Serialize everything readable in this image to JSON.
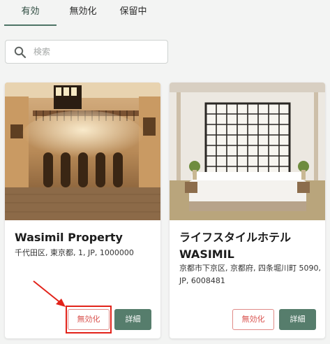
{
  "tabs": [
    {
      "label": "有効",
      "active": true
    },
    {
      "label": "無効化",
      "active": false
    },
    {
      "label": "保留中",
      "active": false
    }
  ],
  "search": {
    "placeholder": "検索",
    "icon": "search-icon"
  },
  "properties": [
    {
      "name": "Wasimil Property",
      "address": "千代田区, 東京都, 1, JP, 1000000",
      "disable_label": "無効化",
      "detail_label": "詳細",
      "image": "hotel-lobby-photo"
    },
    {
      "name": "ライフスタイルホテル WASIMIL",
      "address": "京都市下京区, 京都府, 四条堀川町 5090, JP, 6008481",
      "disable_label": "無効化",
      "detail_label": "詳細",
      "image": "japanese-bedroom-photo"
    }
  ],
  "colors": {
    "accent": "#567d6c",
    "danger": "#d9534f",
    "annotation": "#e2231a"
  }
}
